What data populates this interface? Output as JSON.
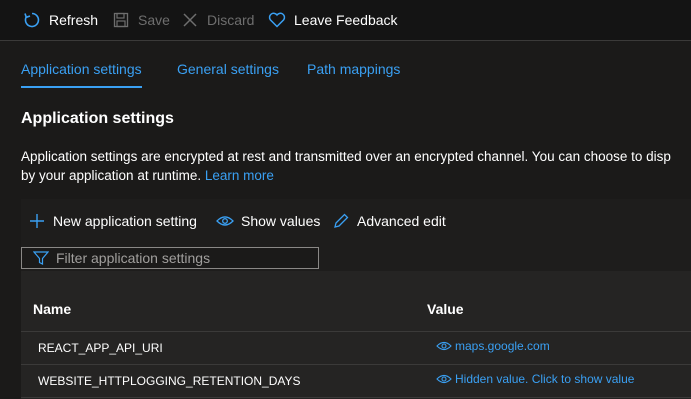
{
  "toolbar": {
    "refresh_label": "Refresh",
    "save_label": "Save",
    "discard_label": "Discard",
    "feedback_label": "Leave Feedback"
  },
  "tabs": [
    {
      "label": "Application settings",
      "active": true
    },
    {
      "label": "General settings",
      "active": false
    },
    {
      "label": "Path mappings",
      "active": false
    }
  ],
  "section": {
    "title": "Application settings",
    "description_line1": "Application settings are encrypted at rest and transmitted over an encrypted channel. You can choose to disp",
    "description_line2": "by your application at runtime.",
    "learn_more": "Learn more"
  },
  "commands": {
    "new_label": "New application setting",
    "show_label": "Show values",
    "advanced_label": "Advanced edit"
  },
  "filter": {
    "placeholder": "Filter application settings"
  },
  "table": {
    "headers": {
      "name": "Name",
      "value": "Value"
    },
    "rows": [
      {
        "name": "REACT_APP_API_URI",
        "value": "maps.google.com"
      },
      {
        "name": "WEBSITE_HTTPLOGGING_RETENTION_DAYS",
        "value": "Hidden value. Click to show value"
      }
    ]
  },
  "colors": {
    "accent": "#3aa0f3",
    "background": "#1b1a19",
    "disabled": "#6e6e6e"
  }
}
